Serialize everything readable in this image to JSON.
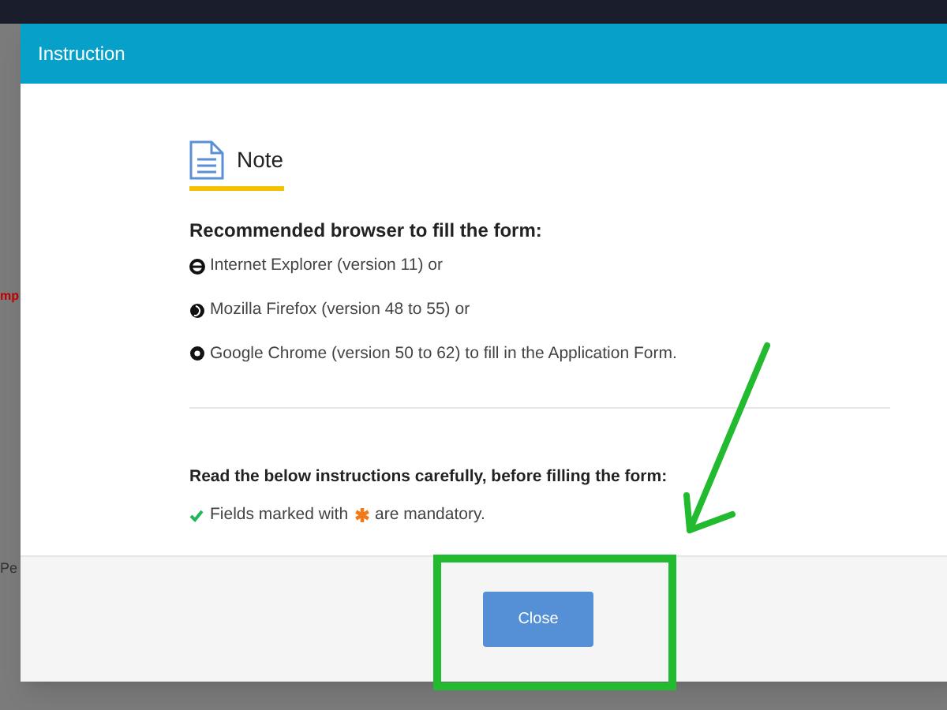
{
  "backdrop": {
    "fragments": [
      {
        "text": "mp",
        "kind": "red"
      },
      {
        "text": "Pe",
        "kind": "plain"
      }
    ]
  },
  "modal": {
    "title": "Instruction",
    "note": {
      "heading": "Note"
    },
    "browsers_heading": "Recommended browser to fill the form:",
    "browsers": [
      {
        "kind": "ie",
        "text": "Internet Explorer (version 11) or"
      },
      {
        "kind": "firefox",
        "text": "Mozilla Firefox (version 48 to 55) or"
      },
      {
        "kind": "chrome",
        "text": "Google Chrome (version 50 to 62) to fill in the Application Form."
      }
    ],
    "instructions_heading": "Read the below instructions carefully, before filling the form:",
    "instructions": [
      {
        "before": "Fields marked with",
        "after": "are mandatory."
      }
    ],
    "footer_button": "Close"
  }
}
